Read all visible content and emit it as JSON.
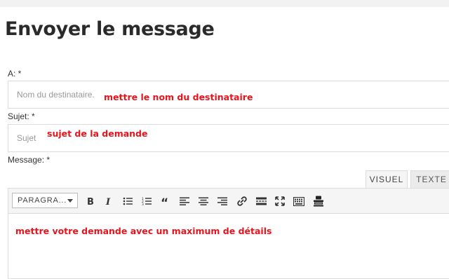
{
  "page": {
    "title": "Envoyer le message"
  },
  "to": {
    "label": "A: *",
    "placeholder": "Nom du destinataire.",
    "annotation": "mettre le nom du destinataire"
  },
  "subject": {
    "label": "Sujet: *",
    "placeholder": "Sujet",
    "annotation": "sujet de la demande"
  },
  "message": {
    "label": "Message: *",
    "tabs": [
      {
        "label": "VISUEL",
        "active": true
      },
      {
        "label": "TEXTE",
        "active": false
      }
    ],
    "format_select": "PARAGRA...",
    "toolbar_icons": [
      "bold-icon",
      "italic-icon",
      "bullet-list-icon",
      "numbered-list-icon",
      "blockquote-icon",
      "align-left-icon",
      "align-center-icon",
      "align-right-icon",
      "link-icon",
      "read-more-icon",
      "fullscreen-icon",
      "toolbar-toggle-icon",
      "contact-form-icon"
    ],
    "annotation": "mettre votre demande avec un maximum de détails"
  },
  "colors": {
    "annotation": "#e8141b",
    "border": "#dcdcdc",
    "toolbar_bg": "#f5f5f5"
  }
}
